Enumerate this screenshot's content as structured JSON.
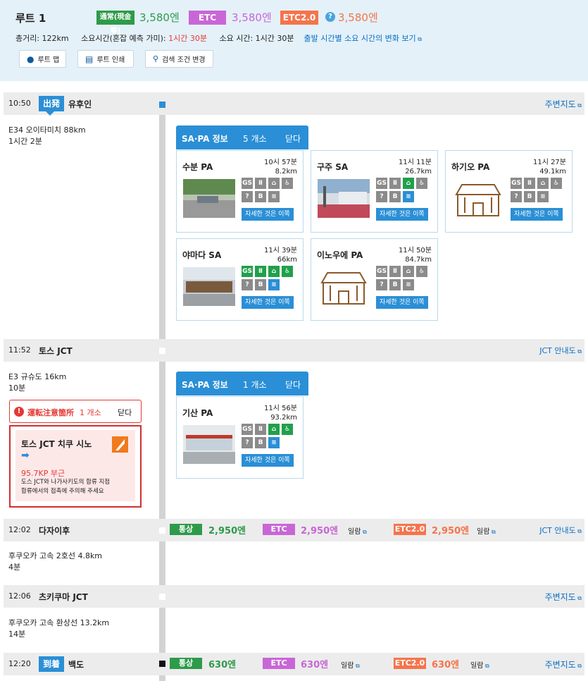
{
  "header": {
    "title": "루트 1",
    "normal_tag": "通常(現金等)",
    "normal_price": "3,580엔",
    "etc_tag": "ETC",
    "etc_price": "3,580엔",
    "etc2_tag": "ETC2.0",
    "etc2_price": "3,580엔",
    "help_icon": "?",
    "distance": "총거리: 122km",
    "time_label": "소요시간(혼잡 예측 가미):",
    "time_value": "1시간 30분",
    "time_plain": "소요 시간: 1시간 30분",
    "time_change_link": "출발 시간별 소요 시간의 변화 보기",
    "buttons": {
      "map": "루트 맵",
      "print": "루트 인쇄",
      "search": "검색 조건 변경"
    }
  },
  "colors": {
    "accent": "#2a8fd6",
    "normal": "#2e9b4a",
    "etc": "#c966d6",
    "etc2": "#f5744c",
    "caution": "#e53935"
  },
  "timeline": {
    "depart": {
      "time": "10:50",
      "badge": "出発",
      "name": "유후인",
      "link": "주변지도"
    },
    "seg1": {
      "road": "E34 오이타미치 88km",
      "time": "1시간 2분"
    },
    "sapa1": {
      "title": "SA·PA 정보",
      "count": "5 개소",
      "close": "닫다",
      "cards": [
        {
          "name": "수분 PA",
          "time": "10시 57분",
          "dist": "8.2km",
          "more": "자세한 것은 이쪽"
        },
        {
          "name": "구주 SA",
          "time": "11시 11분",
          "dist": "26.7km",
          "more": "자세한 것은 이쪽"
        },
        {
          "name": "하기오 PA",
          "time": "11시 27분",
          "dist": "49.1km",
          "more": "자세한 것은 이쪽"
        },
        {
          "name": "야마다 SA",
          "time": "11시 39분",
          "dist": "66km",
          "more": "자세한 것은 이쪽"
        },
        {
          "name": "이노우에 PA",
          "time": "11시 50분",
          "dist": "84.7km",
          "more": "자세한 것은 이쪽"
        }
      ]
    },
    "jct1": {
      "time": "11:52",
      "name": "토스 JCT",
      "link": "JCT 안내도"
    },
    "seg2": {
      "road": "E3 규슈도 16km",
      "time": "10분"
    },
    "caution": {
      "title": "運転注意箇所",
      "count": "1 개소",
      "close": "닫다",
      "box_title": "토스 JCT 치쿠 시노",
      "km": "95.7KP 부근",
      "desc1": "도스 JCT와 나가사키도의 합류 지점",
      "desc2": "합류에서의 접촉에 주의해 주세요"
    },
    "sapa2": {
      "title": "SA·PA 정보",
      "count": "1 개소",
      "close": "닫다",
      "cards": [
        {
          "name": "기산 PA",
          "time": "11시 56분",
          "dist": "93.2km",
          "more": "자세한 것은 이쪽"
        }
      ]
    },
    "ic1": {
      "time": "12:02",
      "name": "다자이후",
      "normal": "통상",
      "normal_price": "2,950엔",
      "etc": "ETC",
      "etc_price": "2,950엔",
      "list": "일람",
      "etc2": "ETC2.0",
      "etc2_price": "2,950엔",
      "list2": "일람",
      "link": "JCT 안내도"
    },
    "seg3": {
      "road": "후쿠오카 고속 2호선 4.8km",
      "time": "4분"
    },
    "jct2": {
      "time": "12:06",
      "name": "츠키쿠마 JCT",
      "link": "주변지도"
    },
    "seg4": {
      "road": "후쿠오카 고속 환상선 13.2km",
      "time": "14분"
    },
    "arrive": {
      "time": "12:20",
      "badge": "到着",
      "name": "백도",
      "normal": "통상",
      "normal_price": "630엔",
      "etc": "ETC",
      "etc_price": "630엔",
      "list": "일람",
      "etc2": "ETC2.0",
      "etc2_price": "630엔",
      "list2": "일람",
      "link": "주변지도"
    }
  }
}
